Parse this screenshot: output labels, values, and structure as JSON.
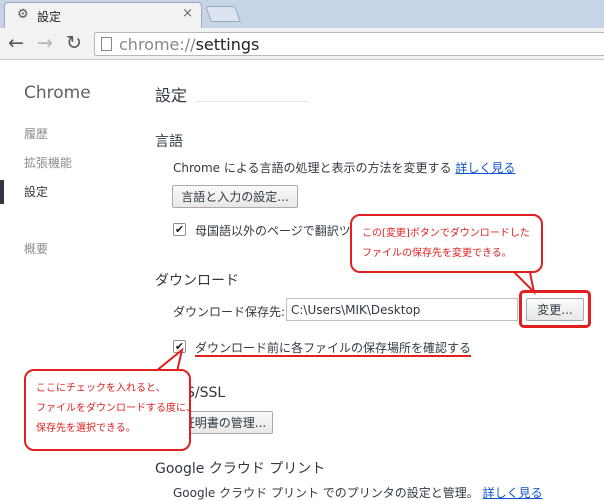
{
  "tab": {
    "icon": "gear-icon",
    "title": "設定",
    "close": "×"
  },
  "toolbar": {
    "back": "←",
    "forward": "→",
    "reload": "↻",
    "url_scheme": "chrome://",
    "url_path": "settings"
  },
  "sidebar": {
    "brand": "Chrome",
    "items": [
      {
        "label": "履歴"
      },
      {
        "label": "拡張機能"
      },
      {
        "label": "設定"
      },
      {
        "label": "概要"
      }
    ]
  },
  "main": {
    "title": "設定",
    "language": {
      "heading": "言語",
      "description": "Chrome による言語の処理と表示の方法を変更する",
      "learn_more": "詳しく見る",
      "settings_button": "言語と入力の設定...",
      "translate_checkbox": "母国語以外のページで翻訳ツ"
    },
    "downloads": {
      "heading": "ダウンロード",
      "location_label": "ダウンロード保存先:",
      "location_value": "C:\\Users\\MIK\\Desktop",
      "change_button": "変更...",
      "ask_checkbox": "ダウンロード前に各ファイルの保存場所を確認する"
    },
    "https": {
      "heading": "S/SSL",
      "manage_button": "証明書の管理..."
    },
    "cloud_print": {
      "heading": "Google クラウド プリント",
      "description": "Google クラウド プリント でのプリンタの設定と管理。",
      "learn_more": "詳しく見る"
    }
  },
  "annotations": {
    "top_right": [
      "この[変更]ボタンでダウンロードした",
      "ファイルの保存先を変更できる。"
    ],
    "bottom_left": [
      "ここにチェックを入れると、",
      "ファイルをダウンロードする度に、",
      "保存先を選択できる。"
    ],
    "color": "#e02020"
  }
}
